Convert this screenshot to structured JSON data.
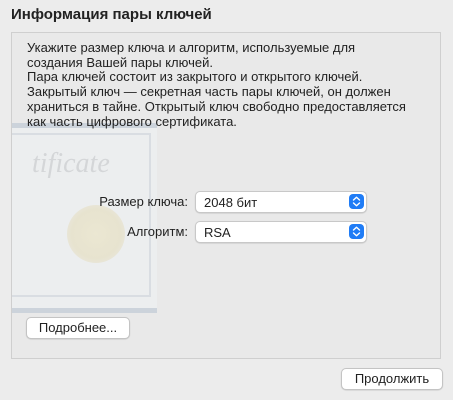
{
  "dialog": {
    "title": "Информация пары ключей"
  },
  "intro": {
    "lines": [
      "Укажите размер ключа и алгоритм, используемые для",
      "создания Вашей пары ключей.",
      "Пара ключей состоит из закрытого и открытого ключей.",
      "Закрытый ключ — секретная часть пары ключей, он должен",
      "храниться в тайне. Открытый ключ свободно предоставляется",
      "как часть цифрового сертификата."
    ]
  },
  "form": {
    "key_size_label": "Размер ключа:",
    "key_size_value": "2048 бит",
    "algorithm_label": "Алгоритм:",
    "algorithm_value": "RSA"
  },
  "watermark": {
    "text": "tificate"
  },
  "buttons": {
    "details": "Подробнее...",
    "continue": "Продолжить"
  },
  "colors": {
    "accent": "#1f7cf6"
  }
}
